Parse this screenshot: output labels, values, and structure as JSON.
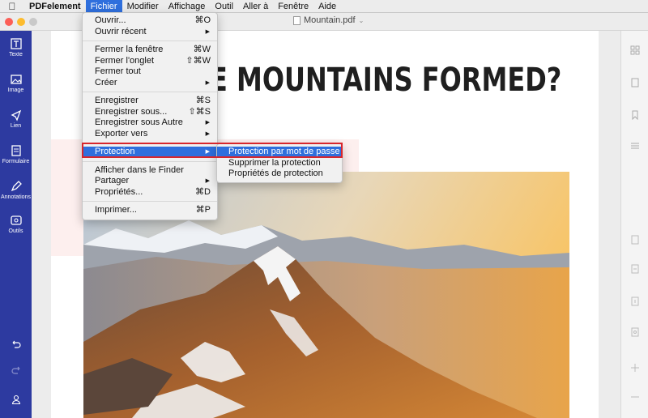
{
  "menubar": {
    "app_name": "PDFelement",
    "items": [
      "Fichier",
      "Modifier",
      "Affichage",
      "Outil",
      "Aller à",
      "Fenêtre",
      "Aide"
    ]
  },
  "window": {
    "document_title": "Mountain.pdf"
  },
  "sidebar": {
    "items": [
      {
        "label": "Texte",
        "icon": "text-tool-icon"
      },
      {
        "label": "Image",
        "icon": "image-icon"
      },
      {
        "label": "Lien",
        "icon": "link-icon"
      },
      {
        "label": "Formulaire",
        "icon": "form-icon"
      },
      {
        "label": "Annotations",
        "icon": "annotation-icon"
      },
      {
        "label": "Outils",
        "icon": "tools-icon"
      }
    ]
  },
  "document": {
    "headline": "E MOUNTAINS FORMED?"
  },
  "file_menu": {
    "ouvrir": {
      "label": "Ouvrir...",
      "shortcut": "⌘O"
    },
    "ouvrir_recent": {
      "label": "Ouvrir récent"
    },
    "fermer_fenetre": {
      "label": "Fermer la fenêtre",
      "shortcut": "⌘W"
    },
    "fermer_onglet": {
      "label": "Fermer l'onglet",
      "shortcut": "⇧⌘W"
    },
    "fermer_tout": {
      "label": "Fermer tout"
    },
    "creer": {
      "label": "Créer"
    },
    "enregistrer": {
      "label": "Enregistrer",
      "shortcut": "⌘S"
    },
    "enregistrer_sous": {
      "label": "Enregistrer sous...",
      "shortcut": "⇧⌘S"
    },
    "enregistrer_autre": {
      "label": "Enregistrer sous Autre"
    },
    "exporter": {
      "label": "Exporter vers"
    },
    "protection": {
      "label": "Protection"
    },
    "afficher_finder": {
      "label": "Afficher dans le Finder"
    },
    "partager": {
      "label": "Partager"
    },
    "proprietes": {
      "label": "Propriétés...",
      "shortcut": "⌘D"
    },
    "imprimer": {
      "label": "Imprimer...",
      "shortcut": "⌘P"
    }
  },
  "protection_submenu": {
    "password": "Protection par mot de passe",
    "remove": "Supprimer la protection",
    "properties": "Propriétés de protection"
  },
  "colors": {
    "sidebar": "#2d3aa0",
    "highlight": "#2f6fdd",
    "callout": "#d8262c"
  }
}
